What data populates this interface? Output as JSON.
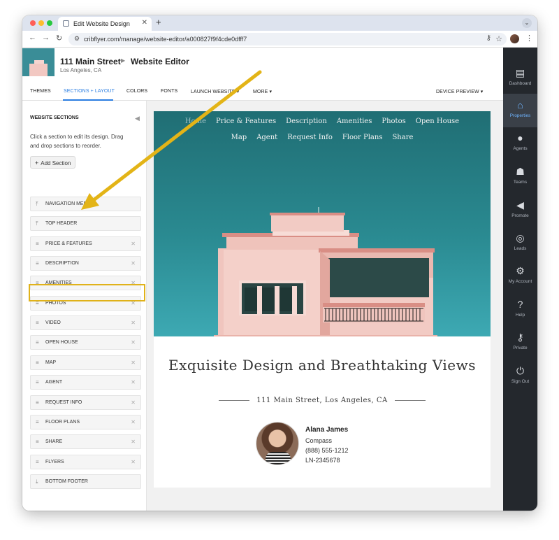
{
  "browser": {
    "tab_title": "Edit Website Design",
    "new_tab": "+",
    "tab_menu": "⌄",
    "url": "cribflyer.com/manage/website-editor/a000827f9f4cde0dfff7"
  },
  "header": {
    "title": "111 Main Street",
    "section": "Website Editor",
    "subtitle": "Los Angeles, CA"
  },
  "top_nav": {
    "themes": "THEMES",
    "sections_layout": "SECTIONS + LAYOUT",
    "colors": "COLORS",
    "fonts": "FONTS",
    "launch_website": "LAUNCH WEBSITE ▾",
    "more": "MORE ▾",
    "device_preview": "DEVICE PREVIEW ▾"
  },
  "left_panel": {
    "title": "WEBSITE SECTIONS",
    "help": "Click a section to edit its design. Drag and drop sections to reorder.",
    "add_section": "Add Section",
    "sections": [
      {
        "label": "NAVIGATION MENU",
        "icon": "pin-top-icon",
        "removable": false
      },
      {
        "label": "TOP HEADER",
        "icon": "pin-top-icon",
        "removable": false
      },
      {
        "label": "PRICE & FEATURES",
        "icon": "drag-handle-icon",
        "removable": true
      },
      {
        "label": "DESCRIPTION",
        "icon": "drag-handle-icon",
        "removable": true
      },
      {
        "label": "AMENITIES",
        "icon": "drag-handle-icon",
        "removable": true
      },
      {
        "label": "PHOTOS",
        "icon": "drag-handle-icon",
        "removable": true
      },
      {
        "label": "VIDEO",
        "icon": "drag-handle-icon",
        "removable": true
      },
      {
        "label": "OPEN HOUSE",
        "icon": "drag-handle-icon",
        "removable": true
      },
      {
        "label": "MAP",
        "icon": "drag-handle-icon",
        "removable": true
      },
      {
        "label": "AGENT",
        "icon": "drag-handle-icon",
        "removable": true
      },
      {
        "label": "REQUEST INFO",
        "icon": "drag-handle-icon",
        "removable": true
      },
      {
        "label": "FLOOR PLANS",
        "icon": "drag-handle-icon",
        "removable": true
      },
      {
        "label": "SHARE",
        "icon": "drag-handle-icon",
        "removable": true
      },
      {
        "label": "FLYERS",
        "icon": "drag-handle-icon",
        "removable": true
      },
      {
        "label": "BOTTOM FOOTER",
        "icon": "pin-bottom-icon",
        "removable": false
      }
    ]
  },
  "preview": {
    "nav_row1": [
      "Home",
      "Price & Features",
      "Description",
      "Amenities",
      "Photos",
      "Open House"
    ],
    "nav_row2": [
      "Map",
      "Agent",
      "Request Info",
      "Floor Plans",
      "Share"
    ],
    "headline": "Exquisite Design and Breathtaking Views",
    "address": "111 Main Street, Los Angeles, CA",
    "agent": {
      "name": "Alana James",
      "company": "Compass",
      "phone": "(888) 555-1212",
      "license": "LN-2345678"
    }
  },
  "right_bar": [
    {
      "label": "Dashboard",
      "icon": "dashboard-icon",
      "glyph": "▤",
      "active": false
    },
    {
      "label": "Properties",
      "icon": "properties-icon",
      "glyph": "⌂",
      "active": true
    },
    {
      "label": "Agents",
      "icon": "agent-icon",
      "glyph": "●",
      "active": false
    },
    {
      "label": "Teams",
      "icon": "teams-icon",
      "glyph": "☗",
      "active": false
    },
    {
      "label": "Promote",
      "icon": "megaphone-icon",
      "glyph": "◀",
      "active": false
    },
    {
      "label": "Leads",
      "icon": "target-icon",
      "glyph": "◎",
      "active": false
    },
    {
      "label": "My Account",
      "icon": "gear-icon",
      "glyph": "⚙",
      "active": false
    },
    {
      "label": "Help",
      "icon": "help-icon",
      "glyph": "?",
      "active": false
    },
    {
      "label": "Private",
      "icon": "key-icon",
      "glyph": "⚷",
      "active": false
    },
    {
      "label": "Sign Out",
      "icon": "power-icon",
      "glyph": "⏻",
      "active": false
    }
  ],
  "colors": {
    "accent": "#2a7de1",
    "highlight": "#e0b21a",
    "sidebar_bg": "#24282d",
    "hero_teal": "#2a8a91"
  }
}
